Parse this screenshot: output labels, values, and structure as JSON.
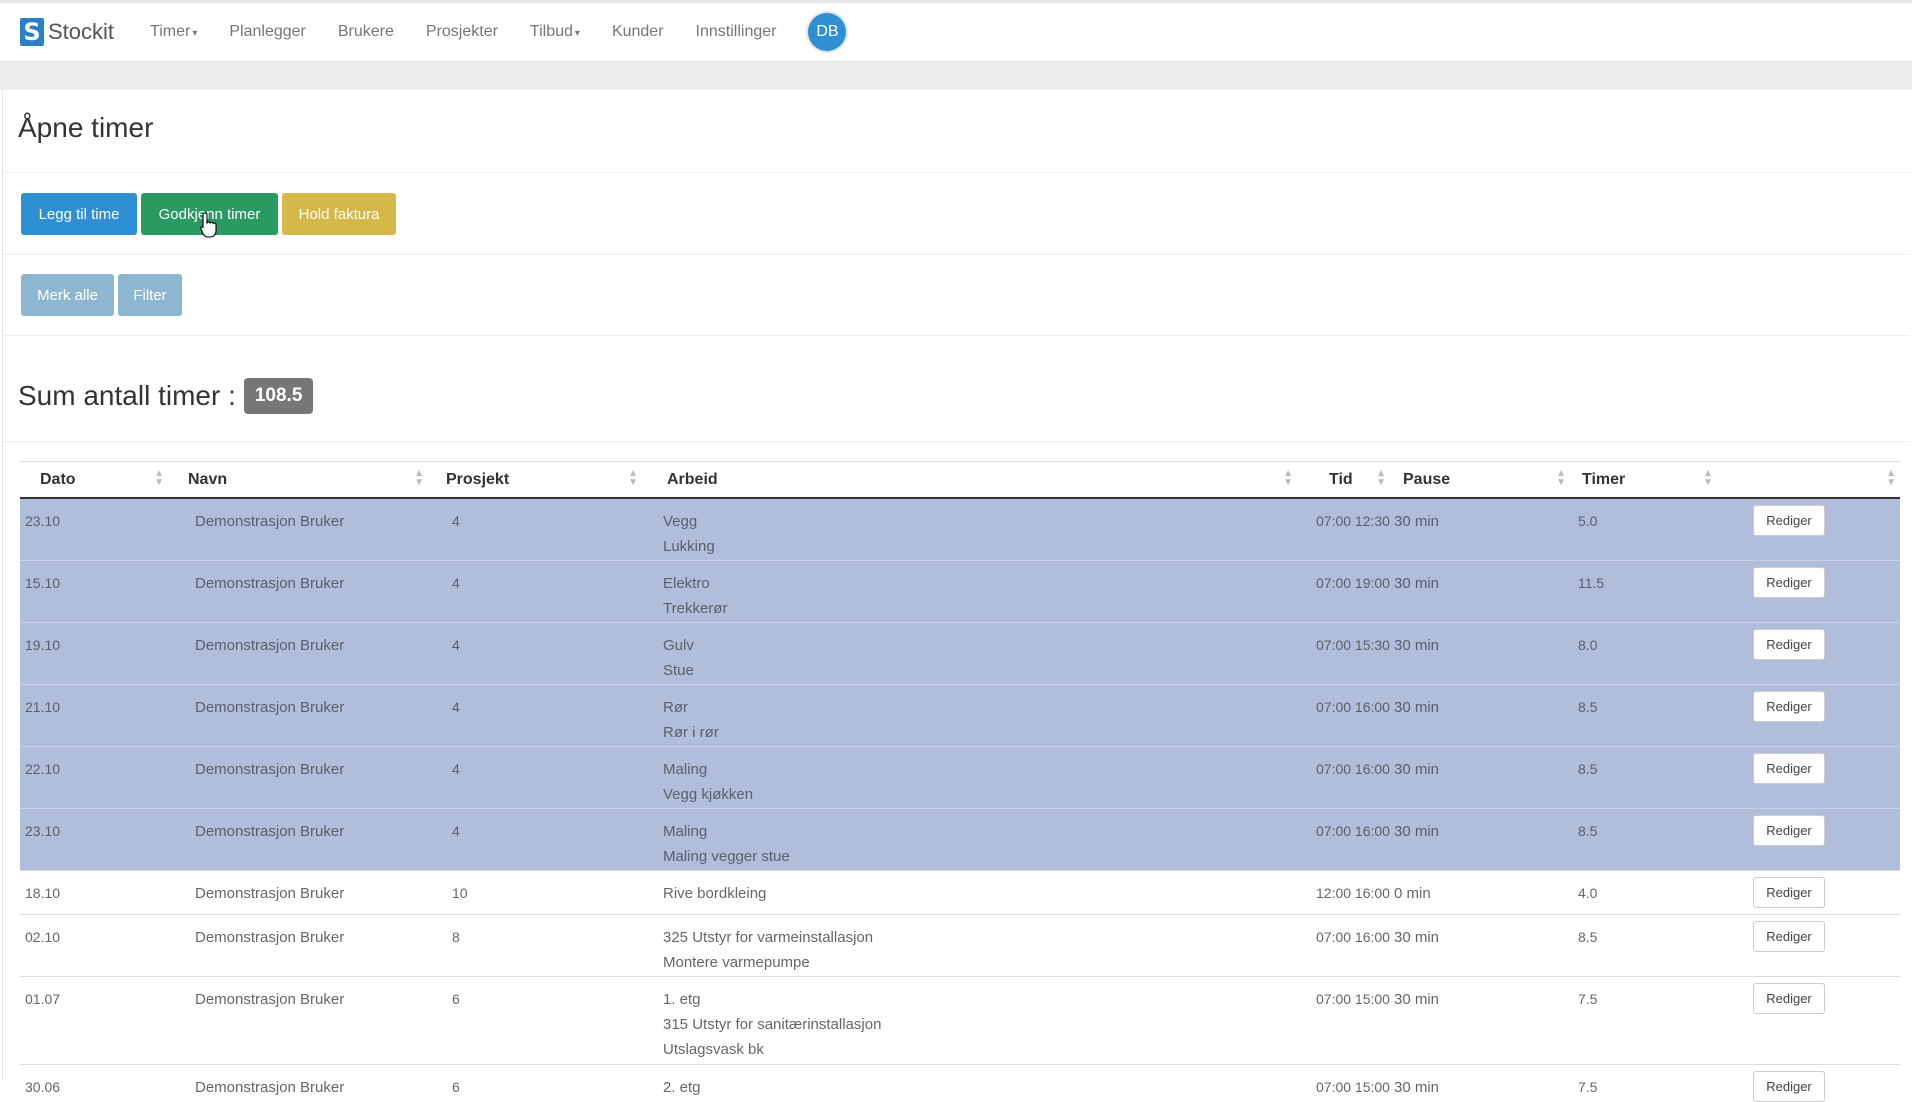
{
  "brand": {
    "logo_letter": "S",
    "name": "Stockit"
  },
  "nav": {
    "items": [
      {
        "label": "Timer",
        "dropdown": true
      },
      {
        "label": "Planlegger",
        "dropdown": false
      },
      {
        "label": "Brukere",
        "dropdown": false
      },
      {
        "label": "Prosjekter",
        "dropdown": false
      },
      {
        "label": "Tilbud",
        "dropdown": true
      },
      {
        "label": "Kunder",
        "dropdown": false
      },
      {
        "label": "Innstillinger",
        "dropdown": false
      }
    ],
    "avatar_initials": "DB"
  },
  "page": {
    "title": "Åpne timer"
  },
  "actions": {
    "add": "Legg til time",
    "approve": "Godkjenn timer",
    "hold": "Hold faktura",
    "select_all": "Merk alle",
    "filter": "Filter"
  },
  "summary": {
    "label": "Sum antall timer :",
    "value": "108.5"
  },
  "table": {
    "headers": {
      "date": "Dato",
      "name": "Navn",
      "project": "Prosjekt",
      "work": "Arbeid",
      "time": "Tid",
      "pause": "Pause",
      "hours": "Timer"
    },
    "edit_label": "Rediger",
    "rows": [
      {
        "date": "23.10",
        "name": "Demonstrasjon Bruker",
        "project": "4",
        "work": [
          "Vegg",
          "Lukking"
        ],
        "time": "07:00 12:30",
        "pause": "30 min",
        "hours": "5.0",
        "selected": true
      },
      {
        "date": "15.10",
        "name": "Demonstrasjon Bruker",
        "project": "4",
        "work": [
          "Elektro",
          "Trekkerør"
        ],
        "time": "07:00 19:00",
        "pause": "30 min",
        "hours": "11.5",
        "selected": true
      },
      {
        "date": "19.10",
        "name": "Demonstrasjon Bruker",
        "project": "4",
        "work": [
          "Gulv",
          "Stue"
        ],
        "time": "07:00 15:30",
        "pause": "30 min",
        "hours": "8.0",
        "selected": true
      },
      {
        "date": "21.10",
        "name": "Demonstrasjon Bruker",
        "project": "4",
        "work": [
          "Rør",
          "Rør i rør"
        ],
        "time": "07:00 16:00",
        "pause": "30 min",
        "hours": "8.5",
        "selected": true
      },
      {
        "date": "22.10",
        "name": "Demonstrasjon Bruker",
        "project": "4",
        "work": [
          "Maling",
          "Vegg kjøkken"
        ],
        "time": "07:00 16:00",
        "pause": "30 min",
        "hours": "8.5",
        "selected": true
      },
      {
        "date": "23.10",
        "name": "Demonstrasjon Bruker",
        "project": "4",
        "work": [
          "Maling",
          "Maling vegger stue"
        ],
        "time": "07:00 16:00",
        "pause": "30 min",
        "hours": "8.5",
        "selected": true
      },
      {
        "date": "18.10",
        "name": "Demonstrasjon Bruker",
        "project": "10",
        "work": [
          "Rive bordkleing"
        ],
        "time": "12:00 16:00",
        "pause": "0 min",
        "hours": "4.0",
        "selected": false
      },
      {
        "date": "02.10",
        "name": "Demonstrasjon Bruker",
        "project": "8",
        "work": [
          "325 Utstyr for varmeinstallasjon",
          "Montere varmepumpe"
        ],
        "time": "07:00 16:00",
        "pause": "30 min",
        "hours": "8.5",
        "selected": false
      },
      {
        "date": "01.07",
        "name": "Demonstrasjon Bruker",
        "project": "6",
        "work": [
          "1. etg",
          "315 Utstyr for sanitærinstallasjon",
          "Utslagsvask bk"
        ],
        "time": "07:00 15:00",
        "pause": "30 min",
        "hours": "7.5",
        "selected": false
      },
      {
        "date": "30.06",
        "name": "Demonstrasjon Bruker",
        "project": "6",
        "work": [
          "2. etg"
        ],
        "time": "07:00 15:00",
        "pause": "30 min",
        "hours": "7.5",
        "selected": false
      }
    ]
  },
  "colors": {
    "primary": "#2f8fd4",
    "success": "#2a9a63",
    "warning": "#d4b84a",
    "muted_button": "#8fb6d0",
    "selected_row": "#b0bedb",
    "badge": "#777777"
  }
}
